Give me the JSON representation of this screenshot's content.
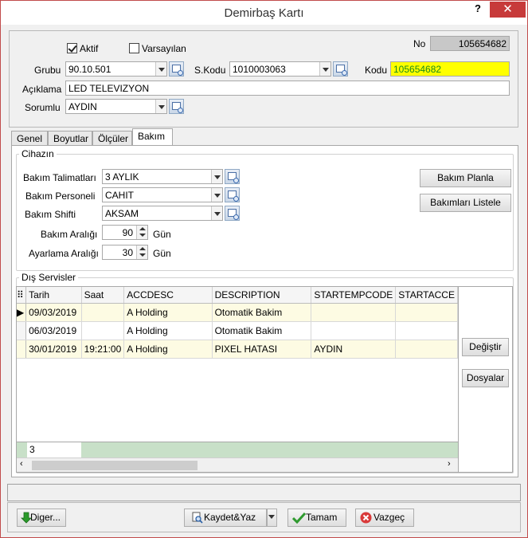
{
  "window": {
    "title": "Demirbaş Kartı",
    "help": "?",
    "close": "✕"
  },
  "header": {
    "aktif_label": "Aktif",
    "varsayilan_label": "Varsayılan",
    "no_label": "No",
    "no_value": "105654682",
    "grubu_label": "Grubu",
    "grubu_value": "90.10.501",
    "skodu_label": "S.Kodu",
    "skodu_value": "1010003063",
    "kodu_label": "Kodu",
    "kodu_value": "105654682",
    "aciklama_label": "Açıklama",
    "aciklama_value": "LED TELEVIZYON",
    "sorumlu_label": "Sorumlu",
    "sorumlu_value": "AYDIN"
  },
  "tabs": [
    {
      "label": "Genel"
    },
    {
      "label": "Boyutlar"
    },
    {
      "label": "Ölçüler"
    },
    {
      "label": "Bakım"
    }
  ],
  "cihazin": {
    "title": "Cihazın",
    "talimat_label": "Bakım Talimatları",
    "talimat_value": "3 AYLIK",
    "personel_label": "Bakım Personeli",
    "personel_value": "CAHIT",
    "shift_label": "Bakım Shifti",
    "shift_value": "AKSAM",
    "aralik_label": "Bakım Aralığı",
    "aralik_value": "90",
    "aralik_unit": "Gün",
    "ayarlama_label": "Ayarlama Aralığı",
    "ayarlama_value": "30",
    "ayarlama_unit": "Gün",
    "planla_button": "Bakım Planla",
    "listele_button": "Bakımları Listele"
  },
  "dis_servisler": {
    "title": "Dış Servisler",
    "columns": [
      "Tarih",
      "Saat",
      "ACCDESC",
      "DESCRIPTION",
      "STARTEMPCODE",
      "STARTACCE"
    ],
    "rows": [
      [
        "09/03/2019",
        "",
        "A Holding",
        "Otomatik Bakim",
        "",
        ""
      ],
      [
        "06/03/2019",
        "",
        "A Holding",
        "Otomatik Bakim",
        "",
        ""
      ],
      [
        "30/01/2019",
        "19:21:00",
        "A Holding",
        "PIXEL HATASI",
        "AYDIN",
        ""
      ]
    ],
    "count": "3",
    "degistir_button": "Değiştir",
    "dosyalar_button": "Dosyalar"
  },
  "footer": {
    "diger_button": "Diger...",
    "kaydet_button": "Kaydet&Yaz",
    "tamam_button": "Tamam",
    "vazgec_button": "Vazgeç"
  }
}
